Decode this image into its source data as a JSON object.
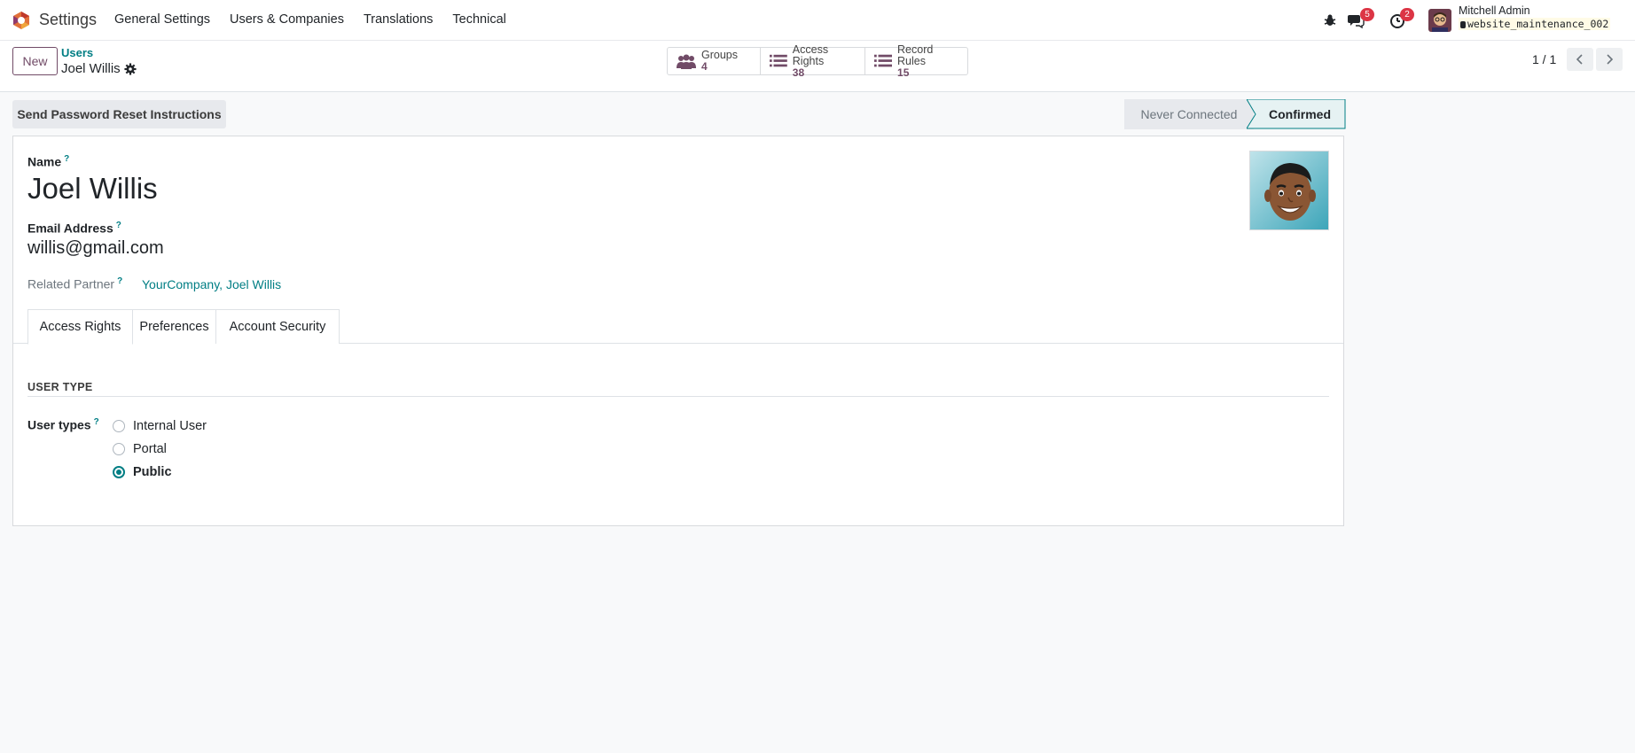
{
  "navbar": {
    "app_name": "Settings",
    "menu": [
      "General Settings",
      "Users & Companies",
      "Translations",
      "Technical"
    ],
    "messages_count": "5",
    "activities_count": "2",
    "user_name": "Mitchell Admin",
    "db_name": "website_maintenance_002"
  },
  "control_panel": {
    "new_label": "New",
    "breadcrumb_parent": "Users",
    "breadcrumb_current": "Joel Willis",
    "smart_buttons": [
      {
        "label": "Groups",
        "value": "4",
        "icon": "users-icon"
      },
      {
        "label": "Access Rights",
        "value": "38",
        "icon": "list-icon"
      },
      {
        "label": "Record Rules",
        "value": "15",
        "icon": "list-icon"
      }
    ],
    "pager": "1 / 1"
  },
  "statusbar": {
    "reset_button": "Send Password Reset Instructions",
    "states": [
      "Never Connected",
      "Confirmed"
    ],
    "active_state": "Confirmed"
  },
  "form": {
    "name_label": "Name",
    "name_value": "Joel Willis",
    "email_label": "Email Address",
    "email_value": "willis@gmail.com",
    "partner_label": "Related Partner",
    "partner_value": "YourCompany, Joel Willis",
    "help_mark": "?",
    "tabs": [
      "Access Rights",
      "Preferences",
      "Account Security"
    ],
    "active_tab": "Access Rights",
    "section_title": "USER TYPE",
    "user_types_label": "User types",
    "user_types": [
      "Internal User",
      "Portal",
      "Public"
    ],
    "selected_user_type": "Public"
  },
  "colors": {
    "brand": "#714b67",
    "accent": "#017e84",
    "badge": "#dc3545"
  }
}
